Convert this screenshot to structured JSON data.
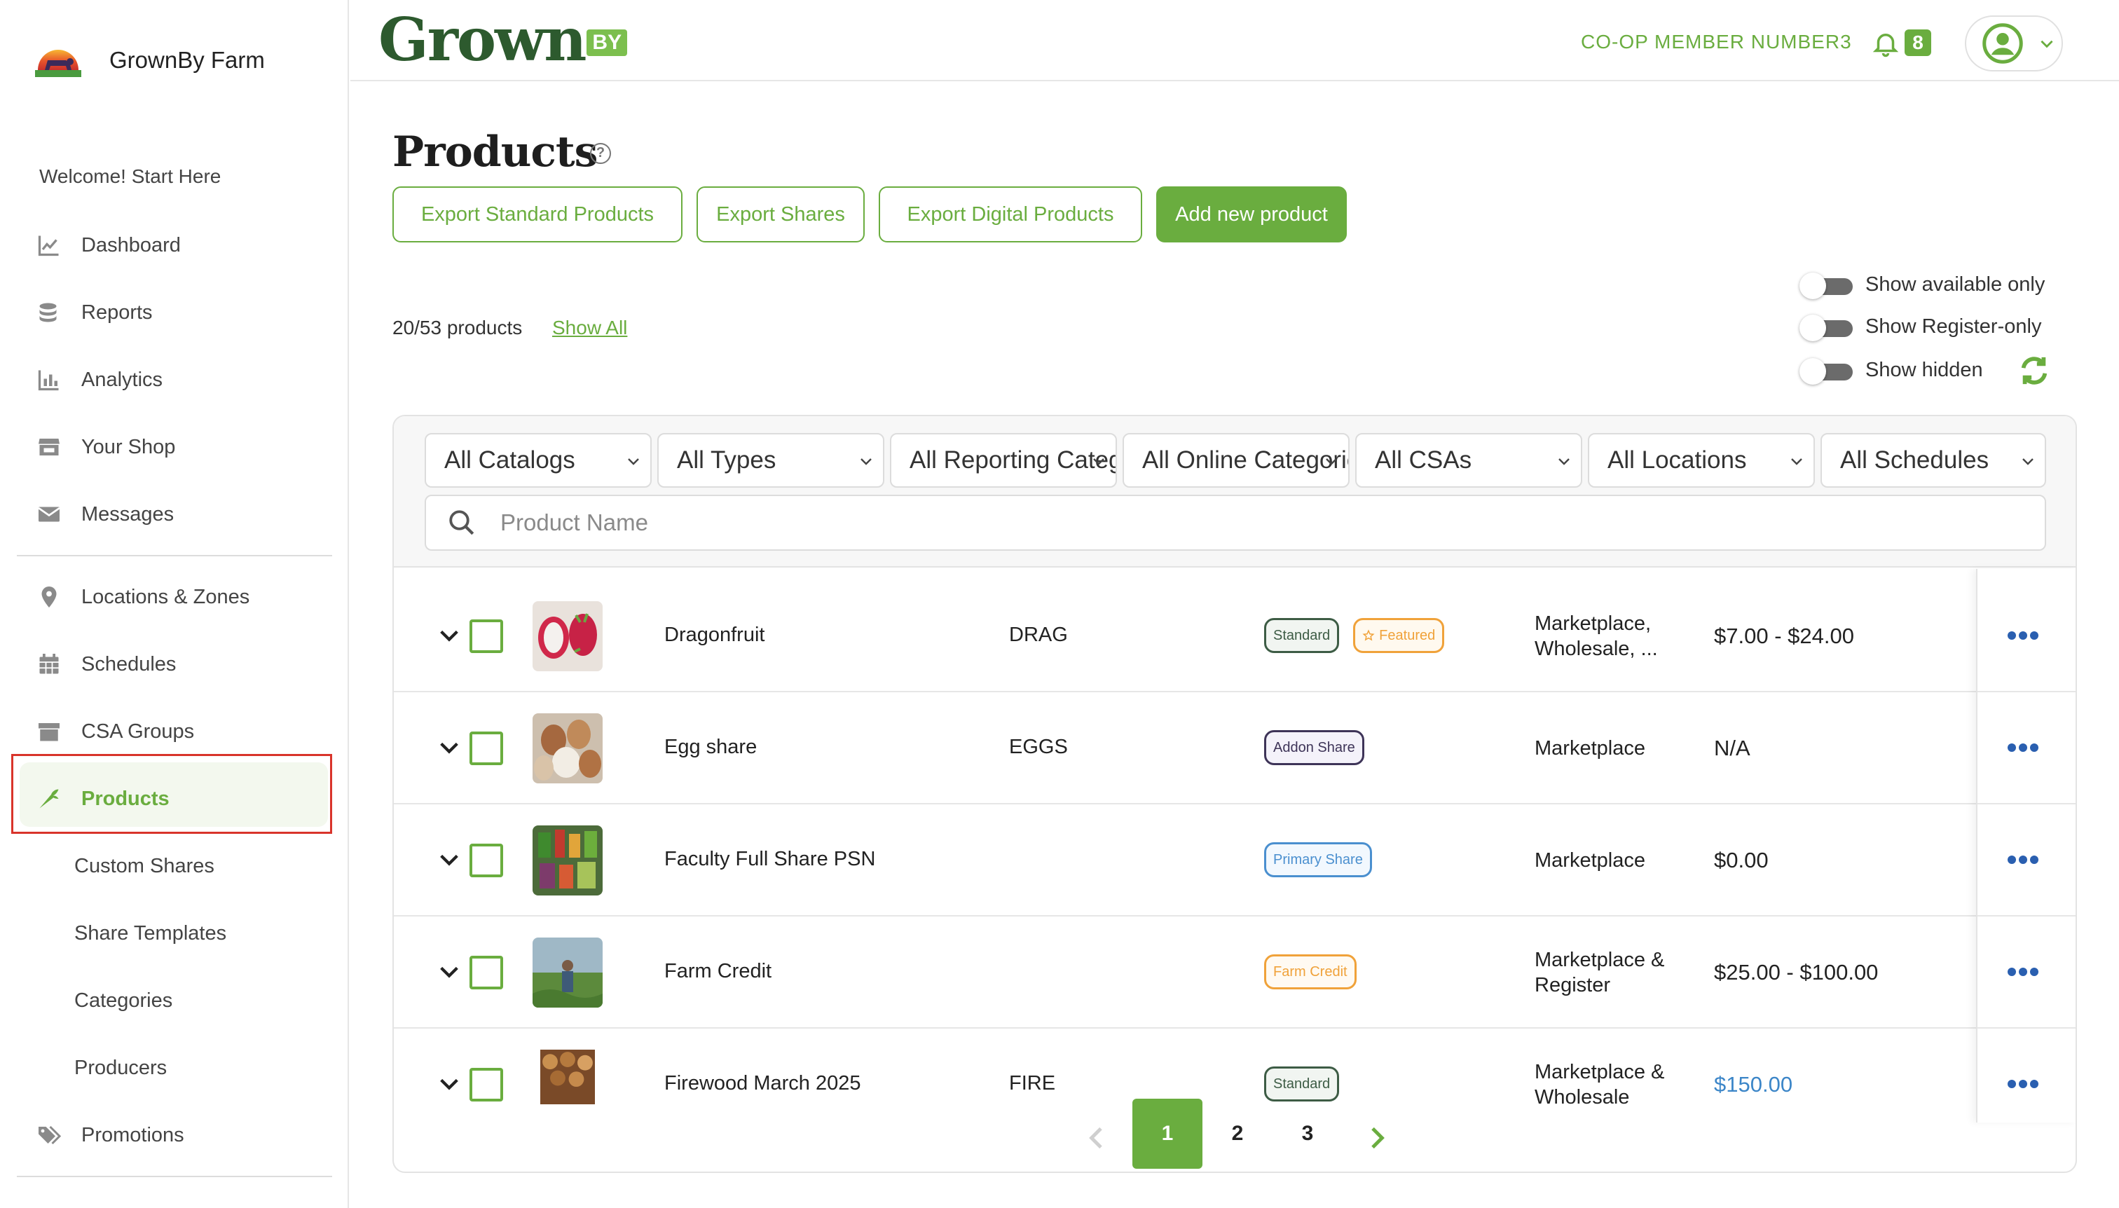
{
  "sidebar": {
    "brand_name": "GrownBy Farm",
    "welcome": "Welcome! Start Here",
    "items": [
      {
        "label": "Dashboard",
        "icon": "chart-line-icon"
      },
      {
        "label": "Reports",
        "icon": "coins-icon"
      },
      {
        "label": "Analytics",
        "icon": "bar-chart-icon"
      },
      {
        "label": "Your Shop",
        "icon": "store-icon"
      },
      {
        "label": "Messages",
        "icon": "envelope-icon"
      },
      {
        "label": "Locations & Zones",
        "icon": "map-pin-icon"
      },
      {
        "label": "Schedules",
        "icon": "calendar-icon"
      },
      {
        "label": "CSA Groups",
        "icon": "box-icon"
      },
      {
        "label": "Products",
        "icon": "carrot-icon",
        "active": true
      },
      {
        "label": "Promotions",
        "icon": "tags-icon"
      }
    ],
    "subitems": [
      "Custom Shares",
      "Share Templates",
      "Categories",
      "Producers"
    ]
  },
  "header": {
    "logo_text": "Grown",
    "logo_badge": "BY",
    "member": "CO-OP MEMBER NUMBER3",
    "notification_count": "8"
  },
  "page": {
    "title": "Products",
    "buttons": {
      "export_standard": "Export Standard Products",
      "export_shares": "Export Shares",
      "export_digital": "Export Digital Products",
      "add_new": "Add new product"
    },
    "count_text": "20/53 products",
    "show_all": "Show All",
    "toggles": [
      {
        "label": "Show available only",
        "on": false
      },
      {
        "label": "Show Register-only",
        "on": false
      },
      {
        "label": "Show hidden",
        "on": false
      }
    ]
  },
  "filters": {
    "catalogs": "All Catalogs",
    "types": "All Types",
    "reporting": "All Reporting Categories",
    "online": "All Online Categories",
    "csas": "All CSAs",
    "locations": "All Locations",
    "schedules": "All Schedules",
    "search_placeholder": "Product Name"
  },
  "products": [
    {
      "name": "Dragonfruit",
      "sku": "DRAG",
      "tags": [
        {
          "label": "Standard",
          "kind": "standard"
        },
        {
          "label": "Featured",
          "kind": "featured"
        }
      ],
      "channels": [
        "Marketplace,",
        "Wholesale, ..."
      ],
      "price": "$7.00 - $24.00"
    },
    {
      "name": "Egg share",
      "sku": "EGGS",
      "tags": [
        {
          "label": "Addon Share",
          "kind": "addon"
        }
      ],
      "channels": [
        "Marketplace"
      ],
      "price": "N/A"
    },
    {
      "name": "Faculty Full Share PSN",
      "sku": "",
      "tags": [
        {
          "label": "Primary Share",
          "kind": "primary"
        }
      ],
      "channels": [
        "Marketplace"
      ],
      "price": "$0.00"
    },
    {
      "name": "Farm Credit",
      "sku": "",
      "tags": [
        {
          "label": "Farm Credit",
          "kind": "credit"
        }
      ],
      "channels": [
        "Marketplace &",
        "Register"
      ],
      "price": "$25.00 - $100.00"
    },
    {
      "name": "Firewood March 2025",
      "sku": "FIRE",
      "tags": [
        {
          "label": "Standard",
          "kind": "standard"
        }
      ],
      "channels": [
        "Marketplace &",
        "Wholesale"
      ],
      "price": "$150.00",
      "price_link": true
    }
  ],
  "pagination": {
    "pages": [
      "1",
      "2",
      "3"
    ],
    "current": "1"
  },
  "colors": {
    "accent": "#6aad3f",
    "logo_dark": "#2d5a2e",
    "highlight": "#d9342b",
    "link_price": "#3c86c8"
  }
}
